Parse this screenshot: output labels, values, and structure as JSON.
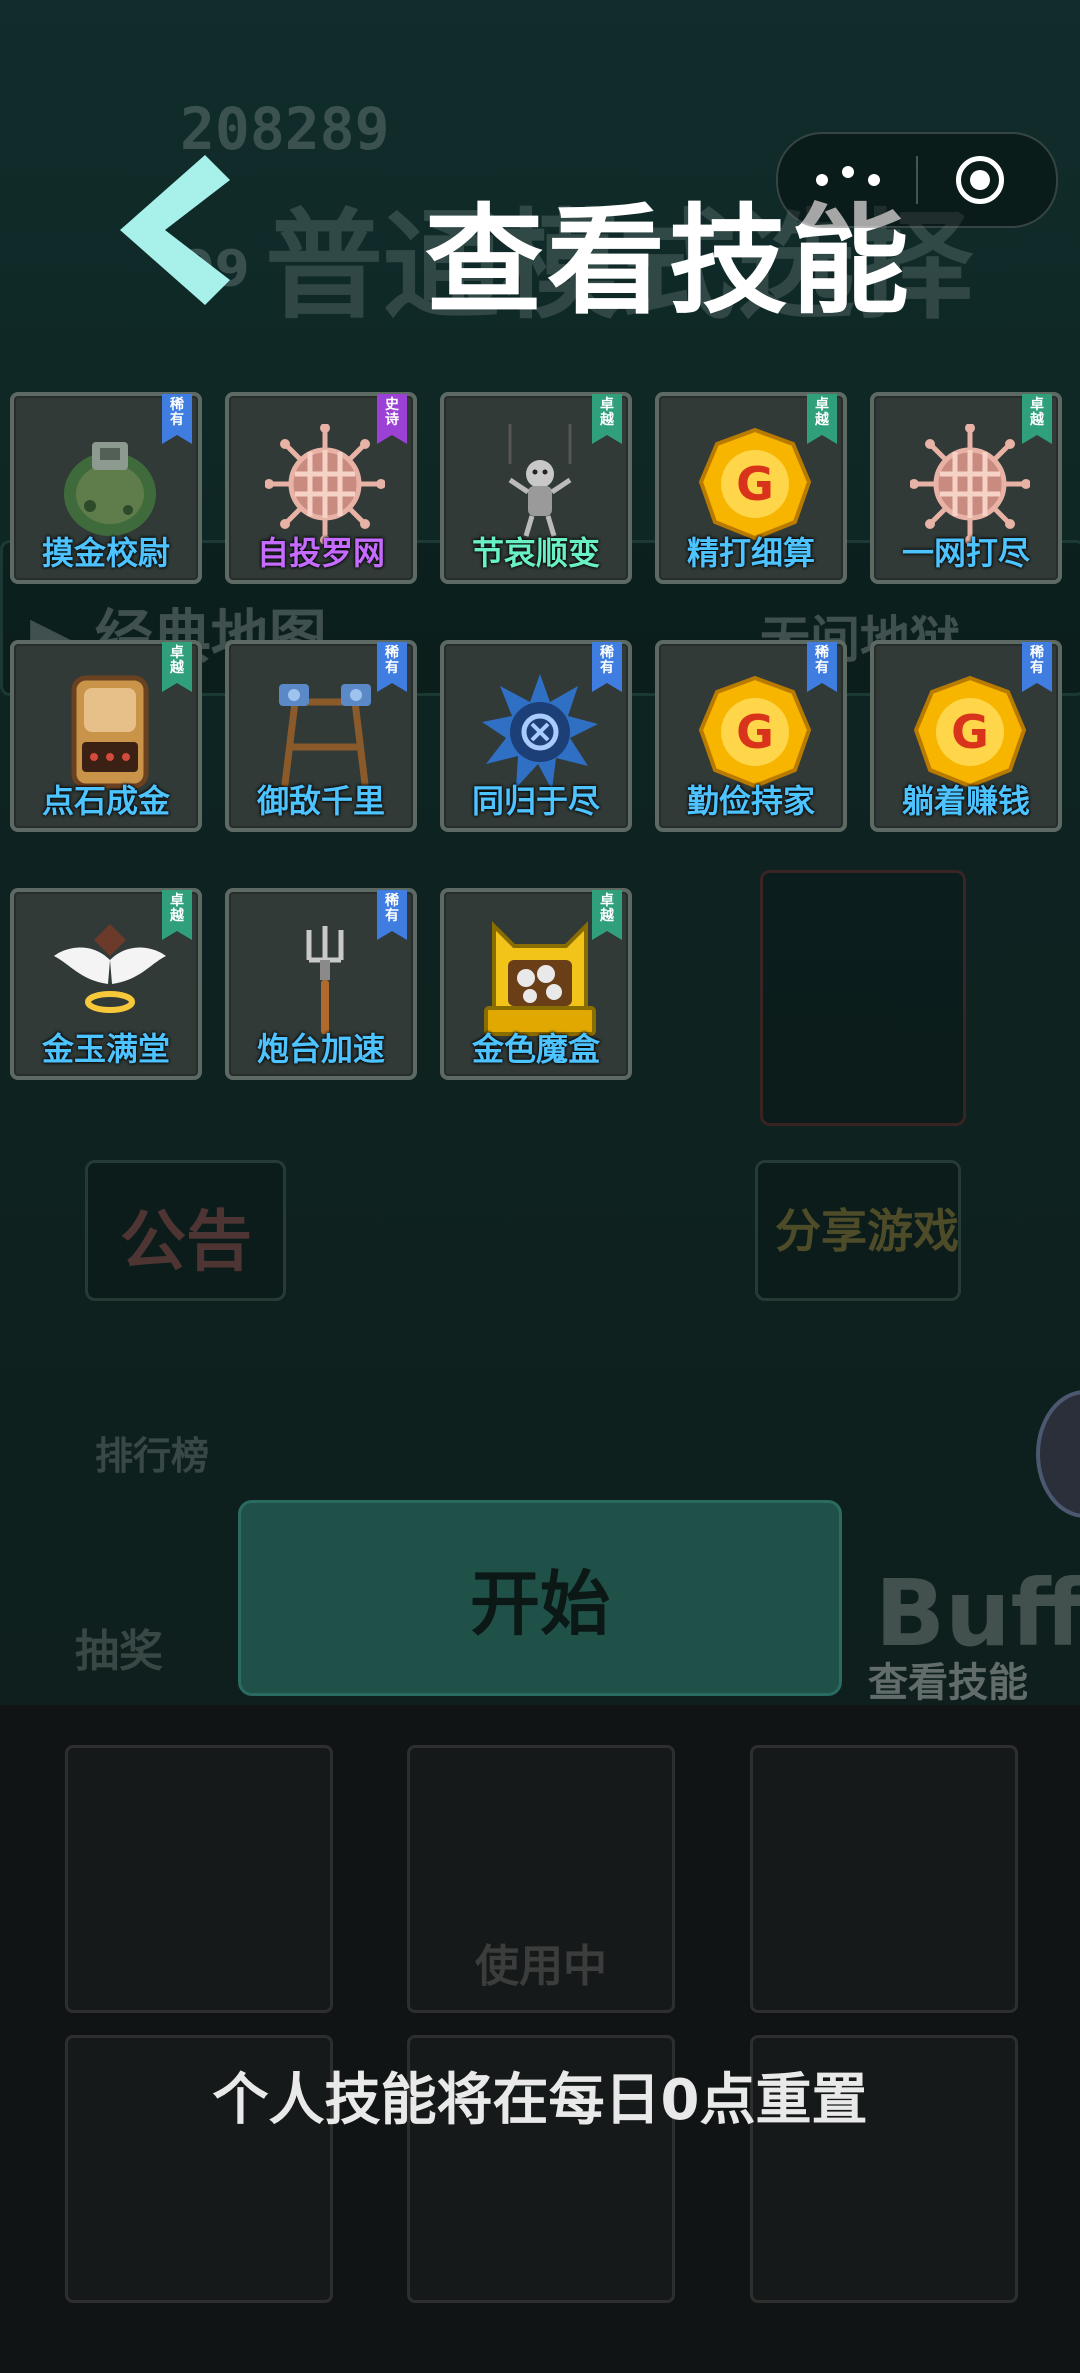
{
  "background": {
    "score": "208289",
    "score2": "99",
    "title_ghost": "普通模式选择",
    "map_left": "▶ 经典地图",
    "map_right": "无间地狱",
    "notice": "公告",
    "share": "分享游戏",
    "rank": "排行榜",
    "lottery": "抽奖",
    "start_label": "开始",
    "buff_label": "Buff",
    "view_skills_label": "查看技能",
    "in_use_label": "使用中"
  },
  "header": {
    "title": "查看技能"
  },
  "skills": [
    {
      "name": "摸金校尉",
      "badge": "稀有",
      "rarity": "rare",
      "icon": "stone-urn-icon"
    },
    {
      "name": "自投罗网",
      "badge": "史诗",
      "rarity": "epic",
      "icon": "net-icon"
    },
    {
      "name": "节哀顺变",
      "badge": "卓越",
      "rarity": "excellent",
      "icon": "puppet-icon"
    },
    {
      "name": "精打细算",
      "badge": "卓越",
      "rarity": "excellent",
      "icon": "gold-coin-icon"
    },
    {
      "name": "一网打尽",
      "badge": "卓越",
      "rarity": "excellent",
      "icon": "net-icon"
    },
    {
      "name": "点石成金",
      "badge": "卓越",
      "rarity": "excellent",
      "icon": "radio-icon"
    },
    {
      "name": "御敌千里",
      "badge": "稀有",
      "rarity": "rare",
      "icon": "turret-stand-icon"
    },
    {
      "name": "同归于尽",
      "badge": "稀有",
      "rarity": "rare",
      "icon": "spiked-ball-icon"
    },
    {
      "name": "勤俭持家",
      "badge": "稀有",
      "rarity": "rare",
      "icon": "gold-coin-icon"
    },
    {
      "name": "躺着赚钱",
      "badge": "稀有",
      "rarity": "rare",
      "icon": "gold-coin-icon"
    },
    {
      "name": "金玉满堂",
      "badge": "卓越",
      "rarity": "excellent",
      "icon": "winged-halo-icon"
    },
    {
      "name": "炮台加速",
      "badge": "稀有",
      "rarity": "rare",
      "icon": "pitchfork-icon"
    },
    {
      "name": "金色魔盒",
      "badge": "卓越",
      "rarity": "excellent",
      "icon": "golden-box-icon"
    }
  ],
  "footer": {
    "reset_notice": "个人技能将在每日0点重置"
  },
  "colors": {
    "rare": "#3f7de0",
    "epic": "#9b41d6",
    "excellent": "#2f9f7c",
    "back_arrow": "#a8f0ea"
  }
}
